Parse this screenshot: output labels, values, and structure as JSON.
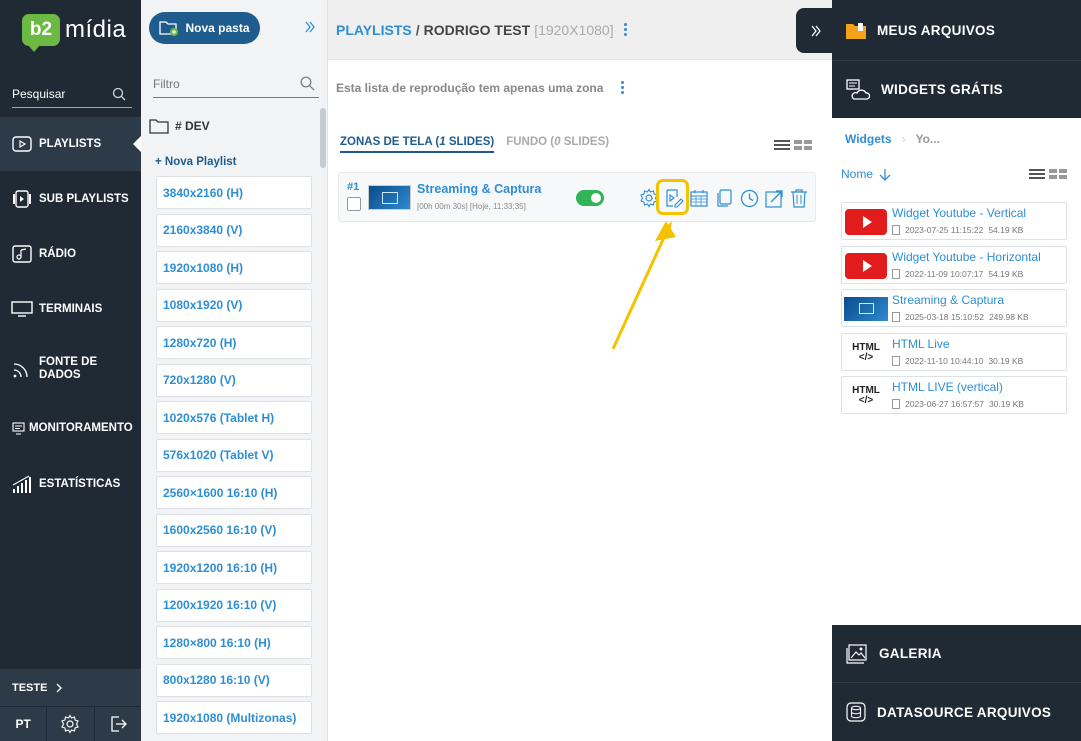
{
  "nav": {
    "logo_prefix": "b2",
    "logo_name": "mídia",
    "search_placeholder": "Pesquisar",
    "items": [
      {
        "label": "PLAYLISTS"
      },
      {
        "label": "SUB PLAYLISTS"
      },
      {
        "label": "RÁDIO"
      },
      {
        "label": "TERMINAIS"
      },
      {
        "label": "FONTE DE DADOS"
      },
      {
        "label": "MONITORAMENTO"
      },
      {
        "label": "ESTATÍSTICAS"
      }
    ],
    "user": "TESTE",
    "language": "PT"
  },
  "folders": {
    "new_folder_label": "Nova pasta",
    "filter_placeholder": "Filtro",
    "folder_name": "# DEV",
    "new_playlist_label": "+ Nova Playlist",
    "playlists": [
      "3840x2160 (H)",
      "2160x3840 (V)",
      "1920x1080 (H)",
      "1080x1920 (V)",
      "1280x720 (H)",
      "720x1280 (V)",
      "1020x576 (Tablet H)",
      "576x1020 (Tablet V)",
      "2560×1600 16:10 (H)",
      "1600x2560 16:10 (V)",
      "1920x1200 16:10 (H)",
      "1200x1920 16:10 (V)",
      "1280×800 16:10 (H)",
      "800x1280 16:10 (V)",
      "1920x1080 (Multizonas)"
    ]
  },
  "main": {
    "breadcrumb_root": "PLAYLISTS",
    "breadcrumb_sep": "/",
    "playlist_name": "RODRIGO TEST",
    "resolution": "[1920X1080]",
    "zone_info": "Esta lista de reprodução tem apenas uma zona",
    "tab_zones": "ZONAS DE TELA (",
    "tab_zones_count": "1",
    "tab_zones_suffix": " SLIDES)",
    "tab_bg": "FUNDO (",
    "tab_bg_count": "0",
    "tab_bg_suffix": " SLIDES)",
    "slide": {
      "number": "#1",
      "title": "Streaming & Captura",
      "meta": "[00h 00m 30s] [Hoje, 11:33:35]",
      "enabled": true
    }
  },
  "right": {
    "my_files": "MEUS ARQUIVOS",
    "free_widgets": "WIDGETS GRÁTIS",
    "crumb_root": "Widgets",
    "crumb_current": "Yo...",
    "sort_label": "Nome",
    "gallery": "GALERIA",
    "datasource": "DATASOURCE ARQUIVOS",
    "widgets": [
      {
        "name": "Widget Youtube - Vertical",
        "date": "2023-07-25 11:15:22",
        "size": "54.19 KB",
        "icon": "youtube-icon"
      },
      {
        "name": "Widget Youtube - Horizontal",
        "date": "2022-11-09 10:07:17",
        "size": "54.19 KB",
        "icon": "youtube-icon"
      },
      {
        "name": "Streaming & Captura",
        "date": "2025-03-18 15:10:52",
        "size": "249.98 KB",
        "icon": "streaming-icon"
      },
      {
        "name": "HTML Live",
        "date": "2022-11-10 10:44:10",
        "size": "30.19 KB",
        "icon": "html-icon"
      },
      {
        "name": "HTML LIVE (vertical)",
        "date": "2023-06-27 16:57:57",
        "size": "30.19 KB",
        "icon": "html-icon"
      }
    ]
  },
  "colors": {
    "nav_bg": "#1f2a35",
    "accent": "#2d8ed6",
    "brand_green": "#6cba44",
    "toggle_on": "#2fb457",
    "highlight": "#f5c200"
  }
}
